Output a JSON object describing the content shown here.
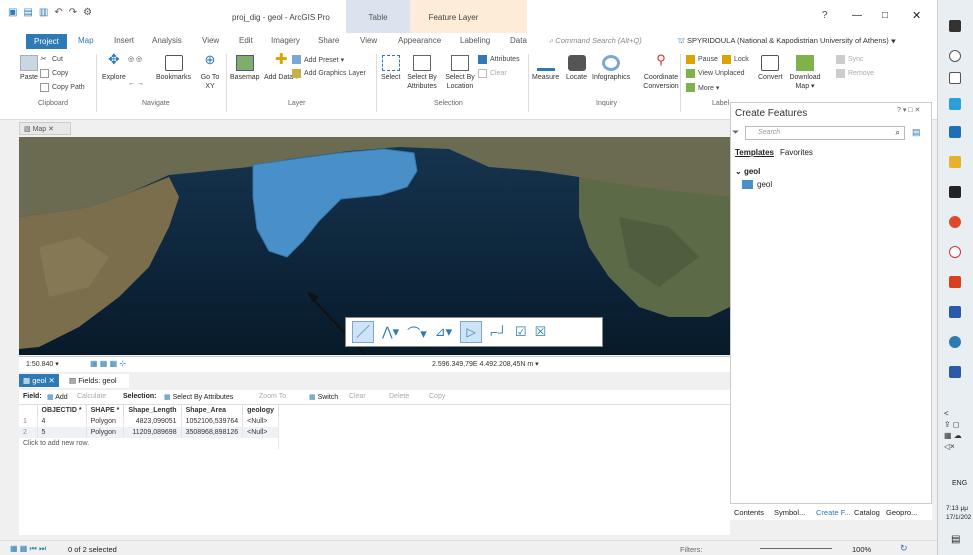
{
  "titlebar": {
    "title": "proj_dig - geol - ArcGIS Pro",
    "ctx_table": "Table",
    "ctx_feature": "Feature Layer",
    "help": "?",
    "minimize": "—",
    "maximize": "□",
    "close": "✕"
  },
  "tabs": {
    "project": "Project",
    "map": "Map",
    "insert": "Insert",
    "analysis": "Analysis",
    "view": "View",
    "edit": "Edit",
    "imagery": "Imagery",
    "share": "Share",
    "view2": "View",
    "appearance": "Appearance",
    "labeling": "Labeling",
    "data": "Data"
  },
  "command_search": "Command Search (Alt+Q)",
  "user": "SPYRIDOULA (National & Kapodistrian University of Athens) ▾",
  "ribbon": {
    "clipboard": {
      "paste": "Paste",
      "cut": "Cut",
      "copy": "Copy",
      "copy_path": "Copy Path",
      "group": "Clipboard"
    },
    "navigate": {
      "explore": "Explore",
      "bookmarks": "Bookmarks",
      "go_to_xy": "Go To XY",
      "group": "Navigate"
    },
    "layer": {
      "basemap": "Basemap",
      "add_data": "Add Data ▾",
      "add_preset": "Add Preset ▾",
      "add_graphics": "Add Graphics Layer",
      "group": "Layer"
    },
    "selection": {
      "select": "Select",
      "select_by_attributes": "Select By Attributes",
      "select_by_location": "Select By Location",
      "attributes": "Attributes",
      "clear": "Clear",
      "group": "Selection"
    },
    "inquiry": {
      "measure": "Measure",
      "locate": "Locate",
      "infographics": "Infographics",
      "coordinate_conversion": "Coordinate Conversion",
      "group": "Inquiry"
    },
    "labeling": {
      "pause": "Pause",
      "lock": "Lock",
      "view_unplaced": "View Unplaced",
      "more": "More ▾",
      "convert": "Convert",
      "download_map": "Download Map ▾",
      "sync": "Sync",
      "remove": "Remove",
      "group": "Label"
    }
  },
  "map_tab": "Map",
  "map_status": {
    "scale": "1:50.840",
    "coords": "2.596.349,79E 4.492.208,45N m"
  },
  "attr_tabs": {
    "layer": "geol",
    "fields": "Fields: geol"
  },
  "field_bar": {
    "field": "Field:",
    "add": "Add",
    "calculate": "Calculate",
    "selection": "Selection:",
    "select_by_attributes": "Select By Attributes",
    "zoom_to": "Zoom To",
    "switch": "Switch",
    "clear": "Clear",
    "delete": "Delete",
    "copy": "Copy"
  },
  "table": {
    "columns": [
      "OBJECTID *",
      "SHAPE *",
      "Shape_Length",
      "Shape_Area",
      "geology"
    ],
    "rows": [
      [
        "1",
        "4",
        "Polygon",
        "4823,099051",
        "1052106,539764",
        "<Null>"
      ],
      [
        "2",
        "5",
        "Polygon",
        "11209,089698",
        "3508968,898126",
        "<Null>"
      ]
    ],
    "add_row": "Click to add new row."
  },
  "bottom": {
    "selected": "0 of 2 selected",
    "filters": "Filters:",
    "zoom": "100%"
  },
  "create_features": {
    "title": "Create Features",
    "search_placeholder": "Search",
    "templates": "Templates",
    "favorites": "Favorites",
    "group": "geol",
    "item": "geol",
    "footer": [
      "Contents",
      "Symbol...",
      "Create F...",
      "Catalog",
      "Geopro..."
    ]
  },
  "taskbar": {
    "lang": "ENG",
    "time": "7:13 μμ",
    "date": "17/1/202"
  },
  "colors": {
    "accent": "#2d7ab4",
    "polygon": "#4a90c8",
    "table_ctx": "#dbe4ee",
    "feature_ctx": "#fcecd8"
  }
}
